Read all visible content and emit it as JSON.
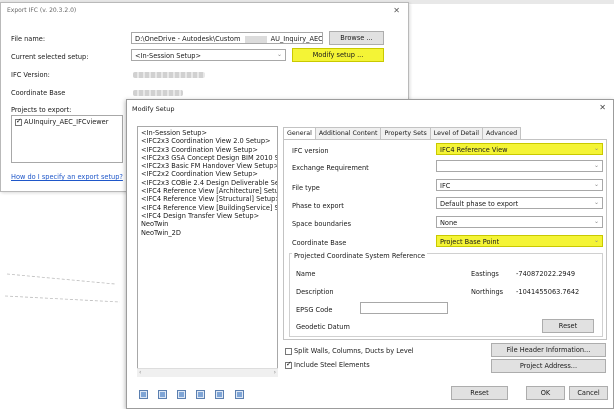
{
  "export_window": {
    "title": "Export IFC (v. 20.3.2.0)",
    "file_name_label": "File name:",
    "file_name_value": "D:\\OneDrive - Autodesk\\Custom",
    "file_name_value_2": "AU_Inquiry_AEC_IFCviewe",
    "browse_label": "Browse ...",
    "current_setup_label": "Current selected setup:",
    "current_setup_value": "<In-Session Setup>",
    "modify_setup_label": "Modify setup ...",
    "ifc_version_label": "IFC Version:",
    "coordinate_base_label": "Coordinate Base",
    "projects_label": "Projects to export:",
    "project_item": "AUInquiry_AEC_IFCviewer",
    "help_link": "How do I specify an export setup?"
  },
  "modify_window": {
    "title": "Modify Setup",
    "setups": [
      "<In-Session Setup>",
      "<IFC2x3 Coordination View 2.0 Setup>",
      "<IFC2x3 Coordination View Setup>",
      "<IFC2x3 GSA Concept Design BIM 2010 Setup>",
      "<IFC2x3 Basic FM Handover View Setup>",
      "<IFC2x2 Coordination View Setup>",
      "<IFC2x3 COBie 2.4 Design Deliverable Setup>",
      "<IFC4 Reference View [Architecture] Setup>",
      "<IFC4 Reference View [Structural] Setup>",
      "<IFC4 Reference View [BuildingService] Setup>",
      "<IFC4 Design Transfer View Setup>",
      "NeoTwin",
      "NeoTwin_2D"
    ],
    "tabs": [
      "General",
      "Additional Content",
      "Property Sets",
      "Level of Detail",
      "Advanced"
    ],
    "general": {
      "ifc_version_label": "IFC version",
      "ifc_version_value": "IFC4 Reference View",
      "exchange_req_label": "Exchange Requirement",
      "exchange_req_value": "",
      "file_type_label": "File type",
      "file_type_value": "IFC",
      "phase_label": "Phase to export",
      "phase_value": "Default phase to export",
      "space_boundaries_label": "Space boundaries",
      "space_boundaries_value": "None",
      "coordinate_base_label": "Coordinate Base",
      "coordinate_base_value": "Project Base Point",
      "pcs_group_title": "Projected Coordinate System Reference",
      "name_label": "Name",
      "eastings_label": "Eastings",
      "eastings_value": "-740872022.2949",
      "description_label": "Description",
      "northings_label": "Northings",
      "northings_value": "-1041455063.7642",
      "epsg_label": "EPSG Code",
      "geodetic_label": "Geodetic Datum",
      "reset_label": "Reset"
    },
    "split_walls_label": "Split Walls, Columns, Ducts by Level",
    "include_steel_label": "Include Steel Elements",
    "file_header_button": "File Header Information...",
    "project_address_button": "Project Address...",
    "reset_button": "Reset",
    "ok_button": "OK",
    "cancel_button": "Cancel"
  },
  "colors": {
    "highlight": "#f4f436",
    "link": "#1f57c9"
  }
}
